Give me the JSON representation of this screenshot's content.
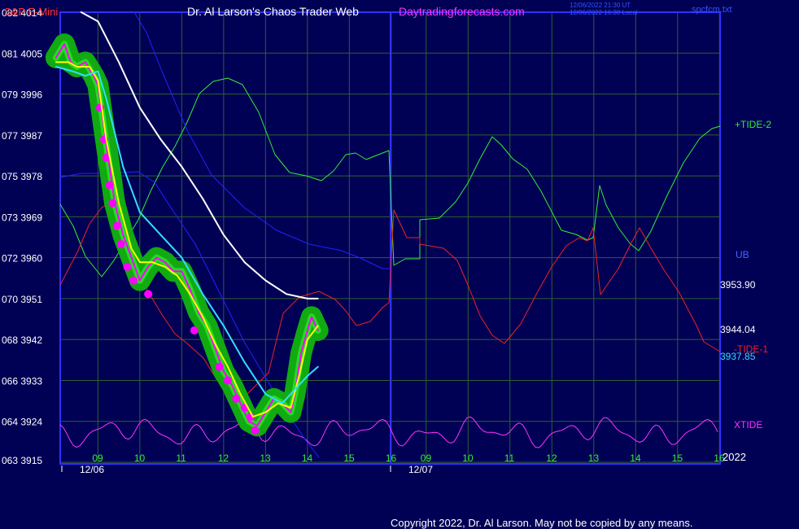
{
  "header": {
    "instrument": "S&P E-Mini",
    "site": "Dr. Al Larson's Chaos Trader Web",
    "url": "Daytradingforecasts.com",
    "stamp1": "12/06/2022 21:30 UT",
    "stamp2": "12/06/2022 16:30 Local",
    "file": "spcfcm.txt"
  },
  "footer": {
    "copyright": "Copyright 2022, Dr. Al Larson. May not be copied by any means.",
    "year": "2022"
  },
  "colors": {
    "background": "#000055",
    "grid": "#2f5f2f",
    "frame": "#3030ff",
    "price_band": "#11aa11",
    "price": "#ff00ff",
    "avg_fast": "#ffff00",
    "avg_cyan": "#33ddff",
    "avg_white": "#ffffff",
    "tide_plus2": "#33ee33",
    "tide_minus1": "#ee2222",
    "blue_band": "#2222ff",
    "xtide": "#ff33ff"
  },
  "chart_data": {
    "type": "line",
    "title": "S&P E-Mini",
    "ylim": [
      3915,
      4014
    ],
    "y_ticks": [
      {
        "code": "082",
        "price": 4014
      },
      {
        "code": "081",
        "price": 4005
      },
      {
        "code": "079",
        "price": 3996
      },
      {
        "code": "077",
        "price": 3987
      },
      {
        "code": "075",
        "price": 3978
      },
      {
        "code": "073",
        "price": 3969
      },
      {
        "code": "072",
        "price": 3960
      },
      {
        "code": "070",
        "price": 3951
      },
      {
        "code": "068",
        "price": 3942
      },
      {
        "code": "066",
        "price": 3933
      },
      {
        "code": "064",
        "price": 3924
      },
      {
        "code": "063",
        "price": 3915
      }
    ],
    "x_ticks": [
      "09",
      "10",
      "11",
      "12",
      "13",
      "14",
      "15",
      "16",
      "09",
      "10",
      "11",
      "12",
      "13",
      "14",
      "15",
      "16"
    ],
    "x_range": [
      8.1,
      16.1
    ],
    "day_labels": [
      {
        "label": "12/06",
        "index": 0
      },
      {
        "label": "12/07",
        "index": 8
      }
    ],
    "right_labels": {
      "tide_plus2": "+TIDE-2",
      "ub": "UB",
      "p1": "3953.90",
      "p2": "3944.04",
      "tide_minus1": "-TIDE-1",
      "p3": "3937.85",
      "xtide": "XTIDE"
    },
    "series": [
      {
        "name": "Price",
        "points": [
          [
            8.0,
            4004
          ],
          [
            8.2,
            4007
          ],
          [
            8.35,
            4003
          ],
          [
            8.5,
            4002
          ],
          [
            8.7,
            4003
          ],
          [
            8.9,
            4000
          ],
          [
            9.0,
            3998
          ],
          [
            9.2,
            3985
          ],
          [
            9.4,
            3972
          ],
          [
            9.6,
            3965
          ],
          [
            9.8,
            3960
          ],
          [
            10.0,
            3955
          ],
          [
            10.2,
            3958
          ],
          [
            10.4,
            3960
          ],
          [
            10.6,
            3959
          ],
          [
            10.8,
            3957
          ],
          [
            11.0,
            3957
          ],
          [
            11.2,
            3953
          ],
          [
            11.4,
            3948
          ],
          [
            11.6,
            3945
          ],
          [
            11.8,
            3940
          ],
          [
            12.0,
            3935
          ],
          [
            12.2,
            3932
          ],
          [
            12.4,
            3928
          ],
          [
            12.6,
            3924
          ],
          [
            12.8,
            3923
          ],
          [
            13.0,
            3926
          ],
          [
            13.2,
            3929
          ],
          [
            13.4,
            3928
          ],
          [
            13.6,
            3926
          ],
          [
            13.7,
            3930
          ],
          [
            13.85,
            3939
          ],
          [
            14.0,
            3944
          ],
          [
            14.1,
            3947
          ],
          [
            14.25,
            3944
          ]
        ]
      },
      {
        "name": "Fast average",
        "points": [
          [
            8.0,
            4003
          ],
          [
            8.3,
            4003
          ],
          [
            8.5,
            4002
          ],
          [
            8.8,
            4002
          ],
          [
            9.0,
            3999
          ],
          [
            9.2,
            3986
          ],
          [
            9.5,
            3972
          ],
          [
            9.8,
            3962
          ],
          [
            10.0,
            3959
          ],
          [
            10.3,
            3959
          ],
          [
            10.6,
            3958
          ],
          [
            10.9,
            3956
          ],
          [
            11.2,
            3952
          ],
          [
            11.5,
            3947
          ],
          [
            11.8,
            3941
          ],
          [
            12.1,
            3936
          ],
          [
            12.4,
            3930
          ],
          [
            12.7,
            3925
          ],
          [
            13.0,
            3926
          ],
          [
            13.3,
            3928
          ],
          [
            13.6,
            3927
          ],
          [
            13.8,
            3934
          ],
          [
            14.0,
            3942
          ],
          [
            14.25,
            3945
          ]
        ]
      },
      {
        "name": "Cyan average",
        "points": [
          [
            8.0,
            4002
          ],
          [
            8.4,
            4001
          ],
          [
            8.7,
            4000
          ],
          [
            9.0,
            4001
          ],
          [
            9.2,
            3995
          ],
          [
            9.6,
            3980
          ],
          [
            10.0,
            3970
          ],
          [
            10.5,
            3965
          ],
          [
            11.0,
            3960
          ],
          [
            11.5,
            3952
          ],
          [
            12.0,
            3945
          ],
          [
            12.5,
            3937
          ],
          [
            13.0,
            3930
          ],
          [
            13.4,
            3928
          ],
          [
            13.7,
            3931
          ],
          [
            14.0,
            3934
          ],
          [
            14.25,
            3936
          ]
        ]
      },
      {
        "name": "White average",
        "points": [
          [
            8.6,
            4014
          ],
          [
            9.0,
            4012
          ],
          [
            9.5,
            4003
          ],
          [
            10.0,
            3993
          ],
          [
            10.5,
            3986
          ],
          [
            11.0,
            3980
          ],
          [
            11.5,
            3973
          ],
          [
            12.0,
            3965
          ],
          [
            12.5,
            3959
          ],
          [
            13.0,
            3955
          ],
          [
            13.5,
            3952
          ],
          [
            14.0,
            3951
          ],
          [
            14.25,
            3951
          ]
        ]
      }
    ]
  }
}
